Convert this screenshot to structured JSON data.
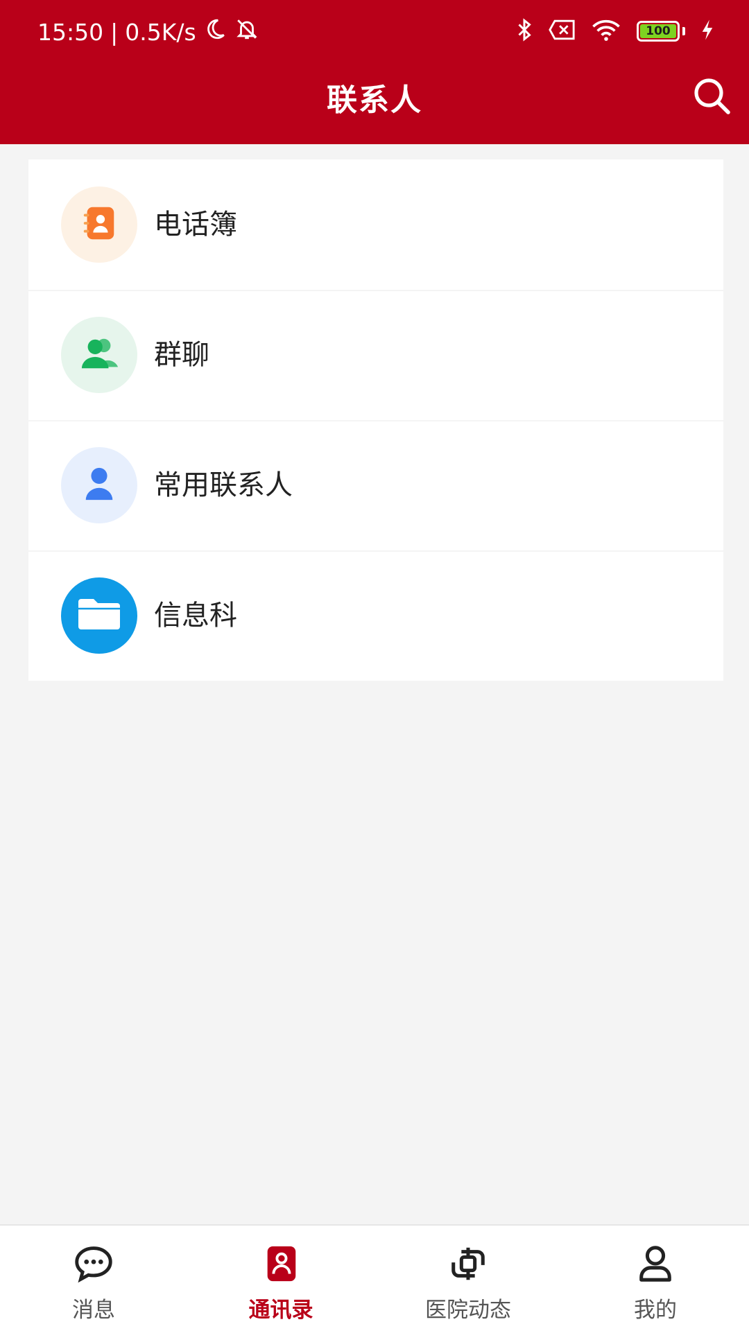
{
  "status_bar": {
    "time": "15:50",
    "separator": "|",
    "net_speed": "0.5K/s",
    "battery_level": "100"
  },
  "header": {
    "title": "联系人"
  },
  "contacts_menu": {
    "items": [
      {
        "label": "电话簿",
        "icon": "phonebook-icon",
        "color": "#f7782d"
      },
      {
        "label": "群聊",
        "icon": "group-chat-icon",
        "color": "#18b35c"
      },
      {
        "label": "常用联系人",
        "icon": "person-icon",
        "color": "#3d7cf0"
      },
      {
        "label": "信息科",
        "icon": "folder-icon",
        "color": "#0f9be6"
      }
    ]
  },
  "bottom_nav": {
    "items": [
      {
        "label": "消息",
        "icon": "chat-bubble-icon"
      },
      {
        "label": "通讯录",
        "icon": "contacts-icon",
        "active": true
      },
      {
        "label": "医院动态",
        "icon": "hospital-news-icon"
      },
      {
        "label": "我的",
        "icon": "profile-icon"
      }
    ]
  },
  "colors": {
    "brand_red": "#b90019",
    "background": "#f4f4f4"
  }
}
